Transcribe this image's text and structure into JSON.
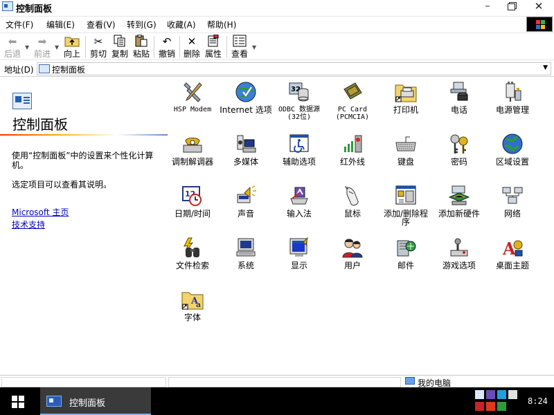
{
  "window": {
    "title": "控制面板",
    "minimize": "–",
    "close": "✕"
  },
  "menu": [
    "文件(F)",
    "编辑(E)",
    "查看(V)",
    "转到(G)",
    "收藏(A)",
    "帮助(H)"
  ],
  "toolbar": {
    "back": "后退",
    "forward": "前进",
    "up": "向上",
    "cut": "剪切",
    "copy": "复制",
    "paste": "粘贴",
    "undo": "撤销",
    "delete": "删除",
    "properties": "属性",
    "view": "查看"
  },
  "address": {
    "label": "地址(D)",
    "value": "控制面板"
  },
  "panel": {
    "title": "控制面板",
    "description": "使用“控制面板”中的设置来个性化计算机。",
    "hint": "选定项目可以查看其说明。",
    "link_home": "Microsoft 主页",
    "link_support": "技术支持"
  },
  "items": [
    {
      "label": "HSP Modem",
      "icon": "tools-icon"
    },
    {
      "label": "Internet 选项",
      "icon": "globe-icon"
    },
    {
      "label": "ODBC 数据源(32位)",
      "icon": "database-icon"
    },
    {
      "label": "PC Card (PCMCIA)",
      "icon": "pc-card-icon"
    },
    {
      "label": "打印机",
      "icon": "printer-folder-icon"
    },
    {
      "label": "电话",
      "icon": "telephony-icon"
    },
    {
      "label": "电源管理",
      "icon": "power-plug-icon"
    },
    {
      "label": "调制解调器",
      "icon": "modem-phone-icon"
    },
    {
      "label": "多媒体",
      "icon": "multimedia-icon"
    },
    {
      "label": "辅助选项",
      "icon": "accessibility-icon"
    },
    {
      "label": "红外线",
      "icon": "infrared-icon"
    },
    {
      "label": "键盘",
      "icon": "keyboard-icon"
    },
    {
      "label": "密码",
      "icon": "keys-icon"
    },
    {
      "label": "区域设置",
      "icon": "globe-regional-icon"
    },
    {
      "label": "日期/时间",
      "icon": "calendar-clock-icon"
    },
    {
      "label": "声音",
      "icon": "speaker-icon"
    },
    {
      "label": "输入法",
      "icon": "keyboard-input-icon"
    },
    {
      "label": "鼠标",
      "icon": "mouse-icon"
    },
    {
      "label": "添加/删除程序",
      "icon": "add-remove-programs-icon"
    },
    {
      "label": "添加新硬件",
      "icon": "add-hardware-icon"
    },
    {
      "label": "网络",
      "icon": "network-icon"
    },
    {
      "label": "文件检索",
      "icon": "binoculars-icon"
    },
    {
      "label": "系统",
      "icon": "computer-icon"
    },
    {
      "label": "显示",
      "icon": "display-icon"
    },
    {
      "label": "用户",
      "icon": "users-icon"
    },
    {
      "label": "邮件",
      "icon": "mail-icon"
    },
    {
      "label": "游戏选项",
      "icon": "joystick-icon"
    },
    {
      "label": "桌面主题",
      "icon": "desktop-themes-icon"
    },
    {
      "label": "字体",
      "icon": "fonts-folder-icon"
    }
  ],
  "status": {
    "location": "我的电脑"
  },
  "taskbar": {
    "task_label": "控制面板",
    "clock": "8:24"
  },
  "colors": {
    "link": "#0000c0",
    "taskbar": "#000000",
    "task_active": "#3a3a3a"
  }
}
